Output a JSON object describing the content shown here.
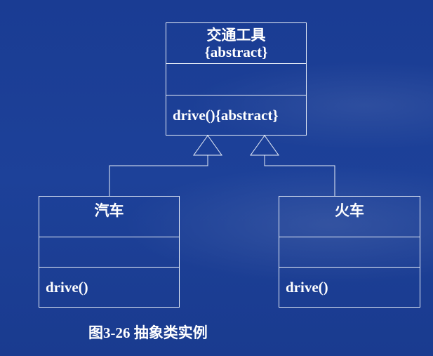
{
  "diagram": {
    "superclass": {
      "name": "交通工具",
      "stereotype": "{abstract}",
      "operation": "drive(){abstract}"
    },
    "subclasses": [
      {
        "id": "car",
        "name": "汽车",
        "operation": "drive()"
      },
      {
        "id": "train",
        "name": "火车",
        "operation": "drive()"
      }
    ],
    "relations": [
      "generalization",
      "generalization"
    ]
  },
  "caption": "图3-26 抽象类实例",
  "colors": {
    "background": "#1b3d93",
    "lines": "#e8eef8",
    "text": "#ffffff"
  }
}
